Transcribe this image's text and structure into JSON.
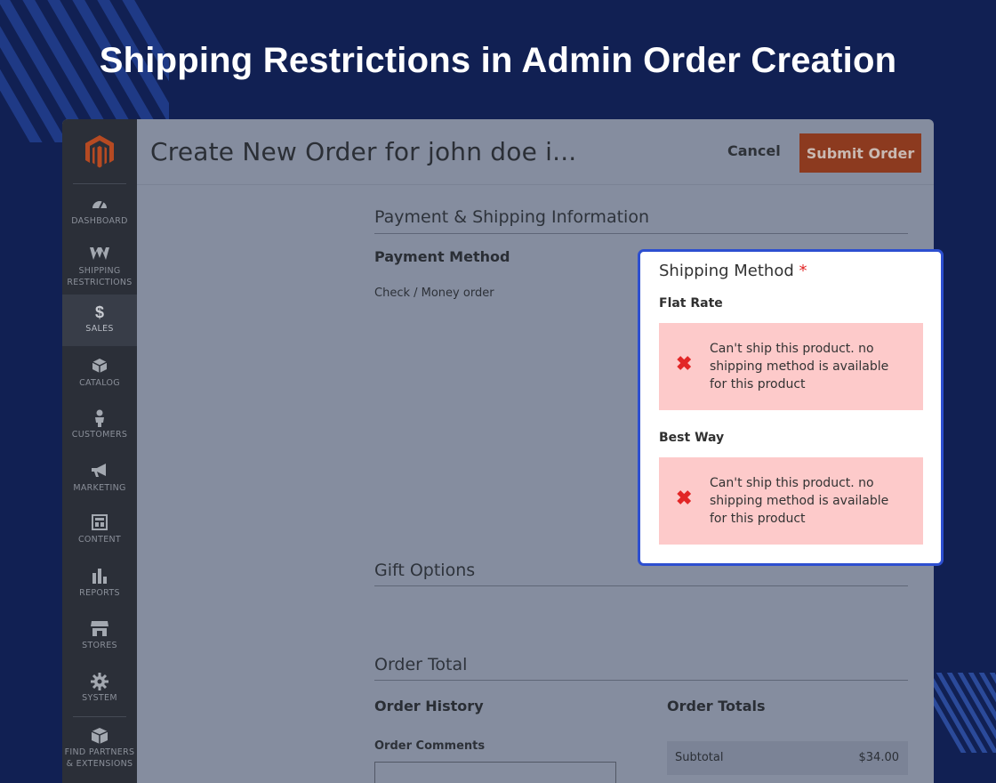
{
  "headline": "Shipping Restrictions in Admin Order Creation",
  "colors": {
    "background": "#112053",
    "sidebar": "#2b2f38",
    "submit_button": "#8c3a1f",
    "highlight_border": "#2d4fd0",
    "error_background": "#fdcaca",
    "error_icon": "#e22626"
  },
  "sidebar": {
    "logo": "magento-logo",
    "items": [
      {
        "label": "DASHBOARD",
        "icon": "speedometer-icon"
      },
      {
        "label": "SHIPPING\nRESTRICTIONS",
        "icon": "amasty-logo-icon"
      },
      {
        "label": "SALES",
        "icon": "dollar-icon",
        "active": true
      },
      {
        "label": "CATALOG",
        "icon": "box-icon"
      },
      {
        "label": "CUSTOMERS",
        "icon": "person-icon"
      },
      {
        "label": "MARKETING",
        "icon": "megaphone-icon"
      },
      {
        "label": "CONTENT",
        "icon": "layout-icon"
      },
      {
        "label": "REPORTS",
        "icon": "bar-chart-icon"
      },
      {
        "label": "STORES",
        "icon": "storefront-icon"
      },
      {
        "label": "SYSTEM",
        "icon": "gear-icon"
      },
      {
        "label": "FIND PARTNERS\n& EXTENSIONS",
        "icon": "cube-icon"
      }
    ]
  },
  "header": {
    "title": "Create New Order for john doe i...",
    "cancel_label": "Cancel",
    "submit_label": "Submit Order"
  },
  "payment_shipping": {
    "section_title": "Payment & Shipping Information",
    "payment_method_title": "Payment Method",
    "payment_method_value": "Check / Money order"
  },
  "shipping_method": {
    "title": "Shipping Method",
    "required_mark": "*",
    "methods": [
      {
        "name": "Flat Rate",
        "error": "Can't ship this product. no shipping method is available for this product",
        "icon": "x-icon"
      },
      {
        "name": "Best Way",
        "error": "Can't ship this product. no shipping method is available for this product",
        "icon": "x-icon"
      }
    ]
  },
  "gift_options": {
    "section_title": "Gift Options"
  },
  "order_total": {
    "section_title": "Order Total",
    "history_title": "Order History",
    "comments_label": "Order Comments",
    "totals_title": "Order Totals",
    "subtotal_label": "Subtotal",
    "subtotal_value": "$34.00"
  }
}
